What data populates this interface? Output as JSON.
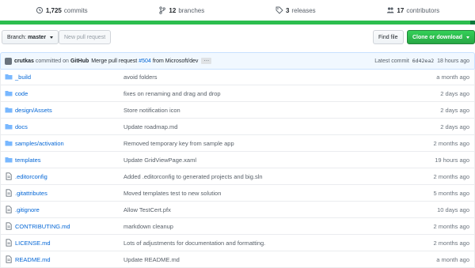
{
  "stats": {
    "commits_count": "1,725",
    "commits_label": "commits",
    "branches_count": "12",
    "branches_label": "branches",
    "releases_count": "3",
    "releases_label": "releases",
    "contributors_count": "17",
    "contributors_label": "contributors"
  },
  "colors": {
    "accent": "#0366d6",
    "language_bar": "#2cbe4e",
    "primary_button": "#28a745"
  },
  "toolbar": {
    "branch_label": "Branch:",
    "branch_value": "master",
    "new_pr_label": "New pull request",
    "find_file_label": "Find file",
    "clone_label": "Clone or download"
  },
  "latest_commit": {
    "author": "crutkas",
    "committed_on": "committed on",
    "via": "GitHub",
    "message_prefix": "Merge pull request",
    "pr": "#504",
    "message_suffix": "from Microsoft/dev",
    "ellipsis": "…",
    "latest_label": "Latest commit",
    "sha": "6d42ea2",
    "age": "18 hours ago"
  },
  "files": [
    {
      "type": "dir",
      "name": "_build",
      "message": "avoid folders",
      "age": "a month ago"
    },
    {
      "type": "dir",
      "name": "code",
      "message": "fixes on renaming and drag and drop",
      "age": "2 days ago"
    },
    {
      "type": "dir",
      "name": "design/Assets",
      "message": "Store notification icon",
      "age": "2 days ago"
    },
    {
      "type": "dir",
      "name": "docs",
      "message": "Update roadmap.md",
      "age": "2 days ago"
    },
    {
      "type": "dir",
      "name": "samples/activation",
      "message": "Removed temporary key from sample app",
      "age": "2 months ago"
    },
    {
      "type": "dir",
      "name": "templates",
      "message": "Update GridViewPage.xaml",
      "age": "19 hours ago"
    },
    {
      "type": "file",
      "name": ".editorconfig",
      "message": "Added .editorconfig to generated projects and big.sln",
      "age": "2 months ago"
    },
    {
      "type": "file",
      "name": ".gitattributes",
      "message": "Moved templates test to new solution",
      "age": "5 months ago"
    },
    {
      "type": "file",
      "name": ".gitignore",
      "message": "Allow TestCert.pfx",
      "age": "10 days ago"
    },
    {
      "type": "file",
      "name": "CONTRIBUTING.md",
      "message": "markdown cleanup",
      "age": "2 months ago"
    },
    {
      "type": "file",
      "name": "LICENSE.md",
      "message": "Lots of adjustments for documentation and formatting.",
      "age": "2 months ago"
    },
    {
      "type": "file",
      "name": "README.md",
      "message": "Update README.md",
      "age": "a month ago"
    }
  ]
}
